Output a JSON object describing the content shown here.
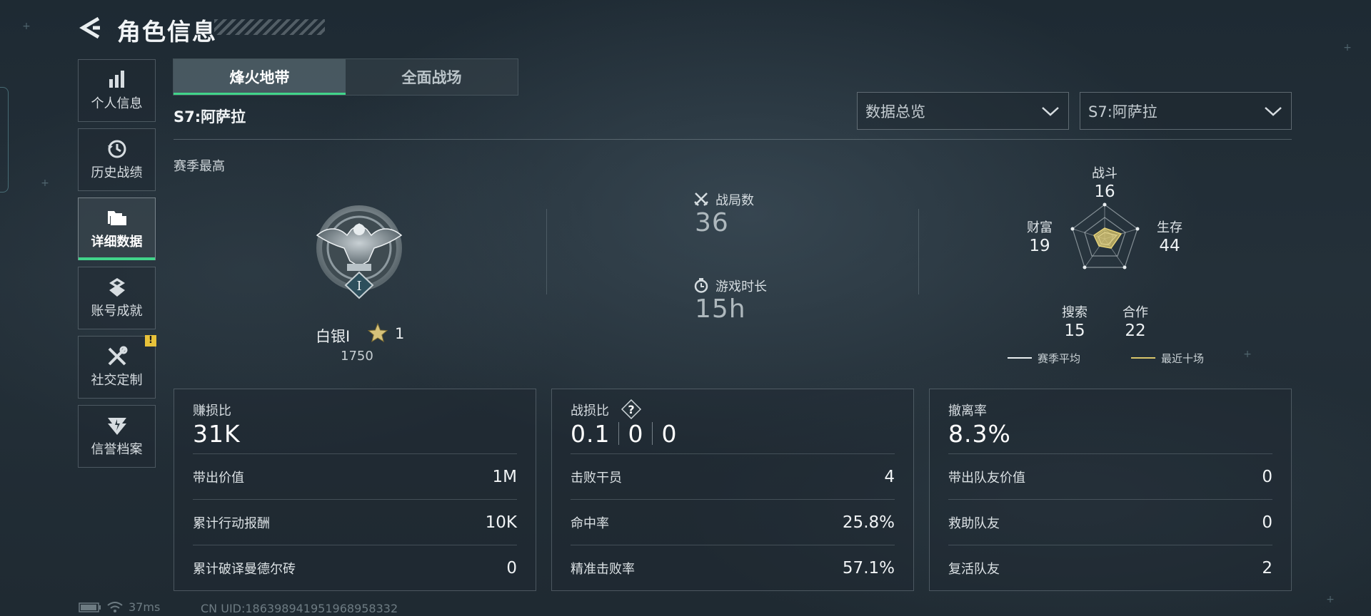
{
  "header": {
    "title": "角色信息"
  },
  "sidebar": {
    "items": [
      {
        "label": "个人信息",
        "icon": "bar-chart-icon"
      },
      {
        "label": "历史战绩",
        "icon": "history-icon"
      },
      {
        "label": "详细数据",
        "icon": "folders-icon",
        "active": true
      },
      {
        "label": "账号成就",
        "icon": "achievement-icon"
      },
      {
        "label": "社交定制",
        "icon": "tools-icon",
        "badge": "!"
      },
      {
        "label": "信誉档案",
        "icon": "credit-shield-icon"
      }
    ]
  },
  "mode_tabs": [
    {
      "label": "烽火地带",
      "active": true
    },
    {
      "label": "全面战场",
      "active": false
    }
  ],
  "season_label": "S7:阿萨拉",
  "filters": {
    "data_type": "数据总览",
    "season": "S7:阿萨拉"
  },
  "season_best": {
    "label": "赛季最高",
    "rank_name": "白银I",
    "rank_numeral": "I",
    "stars": "1",
    "points": "1750"
  },
  "summary": {
    "matches_label": "战局数",
    "matches_value": "36",
    "playtime_label": "游戏时长",
    "playtime_value": "15h"
  },
  "radar": {
    "axes": [
      {
        "label": "战斗",
        "value": "16"
      },
      {
        "label": "生存",
        "value": "44"
      },
      {
        "label": "合作",
        "value": "22"
      },
      {
        "label": "搜索",
        "value": "15"
      },
      {
        "label": "财富",
        "value": "19"
      }
    ],
    "legend": [
      {
        "label": "赛季平均",
        "color": "#e9eef0"
      },
      {
        "label": "最近十场",
        "color": "#d9c56a"
      }
    ]
  },
  "panels": {
    "profit": {
      "title": "赚损比",
      "main": "31K",
      "rows": [
        {
          "label": "带出价值",
          "value": "1M"
        },
        {
          "label": "累计行动报酬",
          "value": "10K"
        },
        {
          "label": "累计破译曼德尔砖",
          "value": "0"
        }
      ]
    },
    "kd": {
      "title": "战损比",
      "main_values": [
        "0.1",
        "0",
        "0"
      ],
      "help": "?",
      "rows": [
        {
          "label": "击败干员",
          "value": "4"
        },
        {
          "label": "命中率",
          "value": "25.8%"
        },
        {
          "label": "精准击败率",
          "value": "57.1%"
        }
      ]
    },
    "extract": {
      "title": "撤离率",
      "main": "8.3%",
      "rows": [
        {
          "label": "带出队友价值",
          "value": "0"
        },
        {
          "label": "救助队友",
          "value": "0"
        },
        {
          "label": "复活队友",
          "value": "2"
        }
      ]
    }
  },
  "status": {
    "ping": "37ms",
    "uid": "CN UID:186398941951968958332"
  },
  "colors": {
    "accent": "#41d48a",
    "radar_recent": "#d9c56a",
    "badge": "#e8c23a"
  }
}
